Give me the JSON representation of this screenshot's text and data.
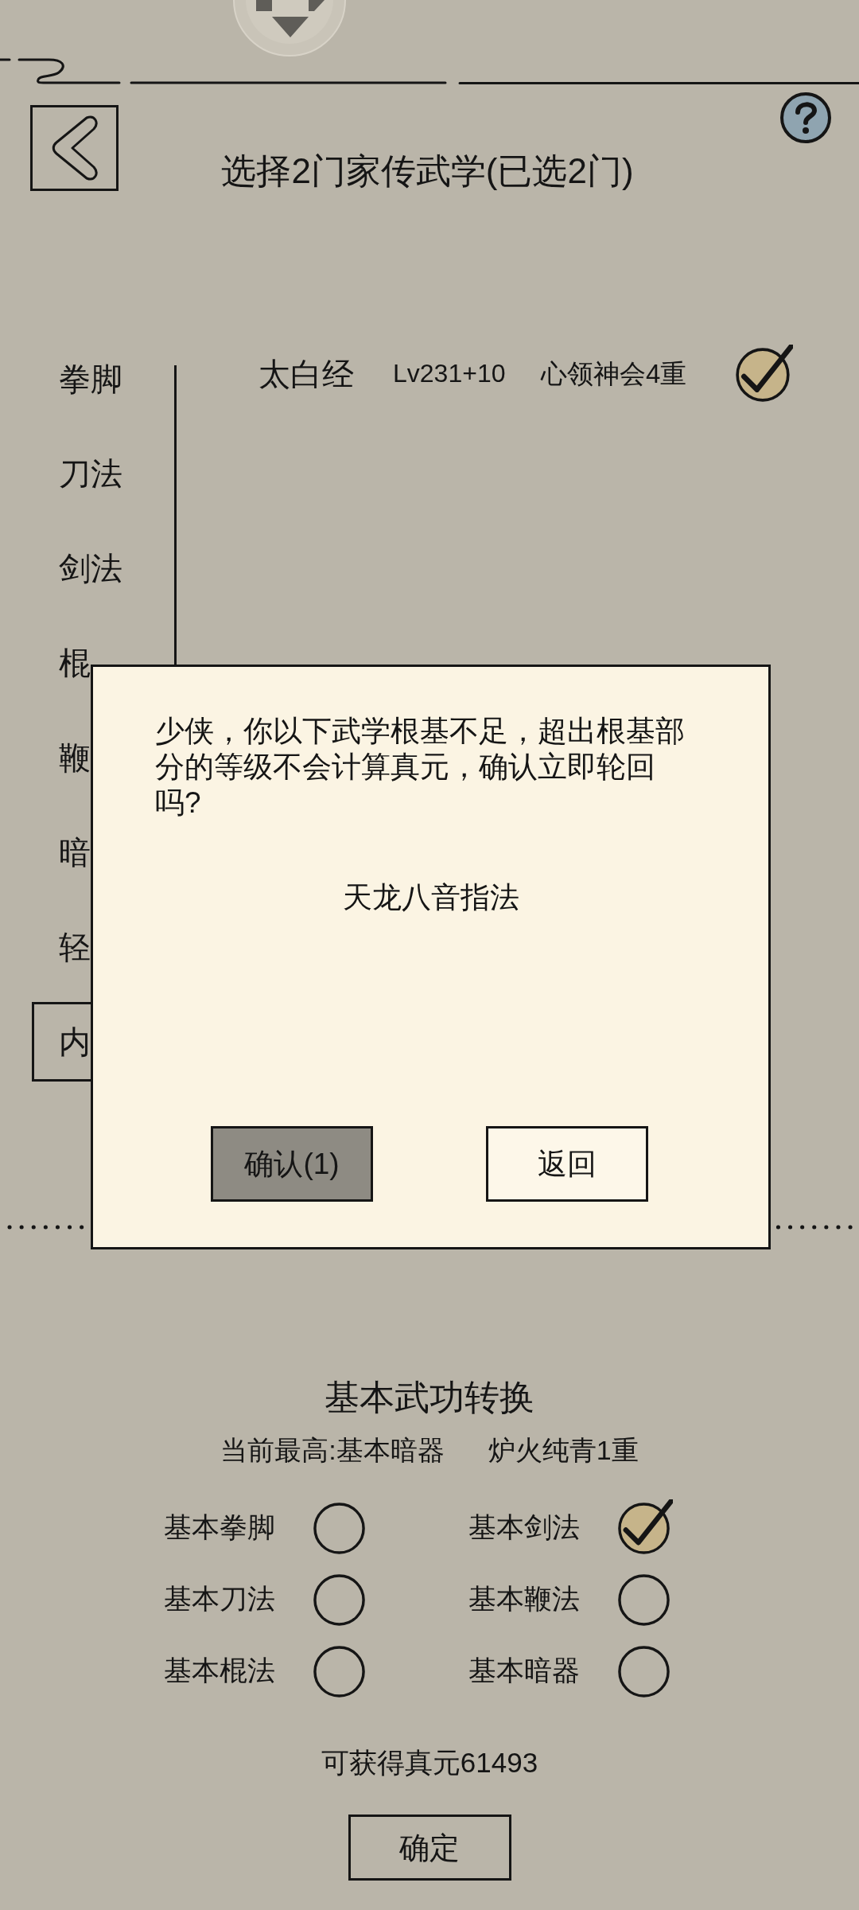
{
  "header": {
    "title": "选择2门家传武学(已选2门)"
  },
  "sidebar": {
    "items": [
      {
        "label": "拳脚",
        "selected": false
      },
      {
        "label": "刀法",
        "selected": false
      },
      {
        "label": "剑法",
        "selected": false
      },
      {
        "label": "棍",
        "selected": false
      },
      {
        "label": "鞭",
        "selected": false
      },
      {
        "label": "暗",
        "selected": false
      },
      {
        "label": "轻",
        "selected": false
      },
      {
        "label": "内",
        "selected": true
      }
    ]
  },
  "skills": [
    {
      "name": "太白经",
      "level": "Lv231+10",
      "mastery": "心领神会4重",
      "checked": true
    }
  ],
  "basic_conversion": {
    "title": "基本武功转换",
    "current_highest": "当前最高:基本暗器",
    "rank": "炉火纯青1重",
    "items": [
      {
        "label": "基本拳脚",
        "checked": false
      },
      {
        "label": "基本剑法",
        "checked": true
      },
      {
        "label": "基本刀法",
        "checked": false
      },
      {
        "label": "基本鞭法",
        "checked": false
      },
      {
        "label": "基本棍法",
        "checked": false
      },
      {
        "label": "基本暗器",
        "checked": false
      }
    ],
    "gain": "可获得真元61493",
    "confirm_button": "确定"
  },
  "dialog": {
    "message": "少侠，你以下武学根基不足，超出根基部分的等级不会计算真元，确认立即轮回吗?",
    "skills": [
      "天龙八音指法"
    ],
    "buttons": [
      {
        "label": "确认(1)",
        "kind": "primary"
      },
      {
        "label": "返回",
        "kind": "secondary"
      }
    ]
  }
}
